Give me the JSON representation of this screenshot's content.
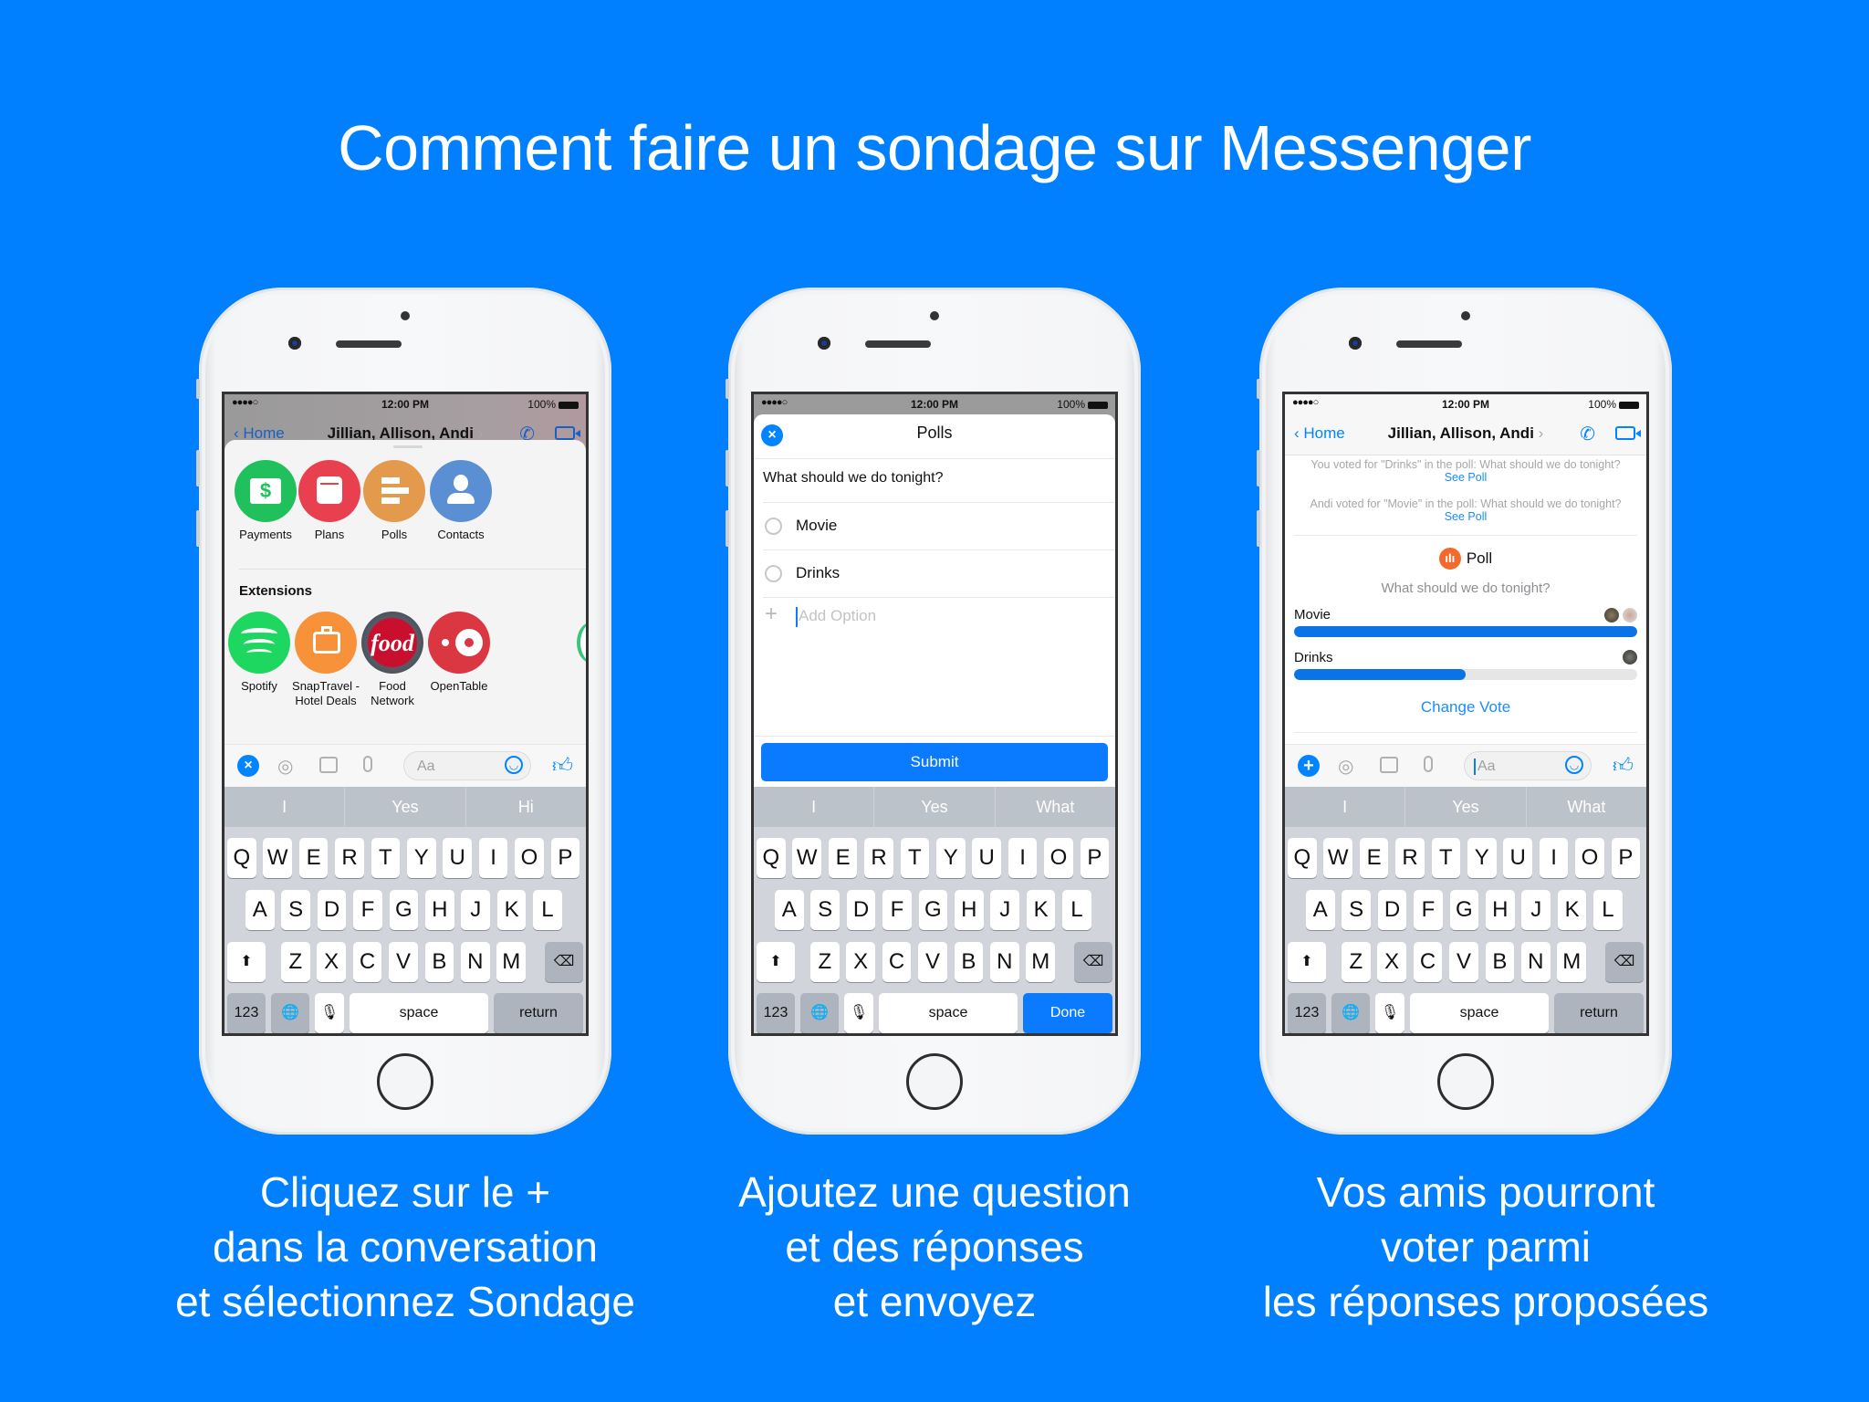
{
  "title": "Comment faire un sondage sur Messenger",
  "colors": {
    "background": "#0080ff",
    "messenger_blue": "#0084ff",
    "bar_fill": "#0a74e6"
  },
  "status_bar": {
    "signal": "●●●●○",
    "wifi_icon": "wifi-icon",
    "time": "12:00 PM",
    "battery": "100%"
  },
  "keyboard": {
    "row1": [
      "Q",
      "W",
      "E",
      "R",
      "T",
      "Y",
      "U",
      "I",
      "O",
      "P"
    ],
    "row2": [
      "A",
      "S",
      "D",
      "F",
      "G",
      "H",
      "J",
      "K",
      "L"
    ],
    "row3": [
      "Z",
      "X",
      "C",
      "V",
      "B",
      "N",
      "M"
    ],
    "shift_icon": "⬆",
    "delete_icon": "⌫",
    "num_label": "123",
    "globe_icon": "🌐",
    "mic_icon": "🎙",
    "space_label": "space"
  },
  "phones": [
    {
      "caption": [
        "Cliquez sur le +",
        "dans la conversation",
        "et sélectionnez Sondage"
      ],
      "nav": {
        "back": "Home",
        "title": "Jillian, Allison, Andi",
        "chevron": "›"
      },
      "apps": [
        {
          "label": "Payments",
          "icon": "payments-icon",
          "color": "#20c05c"
        },
        {
          "label": "Plans",
          "icon": "calendar-icon",
          "color": "#e9404f"
        },
        {
          "label": "Polls",
          "icon": "polls-icon",
          "color": "#e39a4c"
        },
        {
          "label": "Contacts",
          "icon": "contact-icon",
          "color": "#5a8fd3"
        }
      ],
      "extensions_heading": "Extensions",
      "extensions": [
        {
          "label": [
            "Spotify"
          ],
          "color": "#1ed760"
        },
        {
          "label": [
            "SnapTravel -",
            "Hotel Deals"
          ],
          "color": "#f7913a"
        },
        {
          "label": [
            "Food",
            "Network"
          ],
          "color": "#c8102e",
          "badge": "food"
        },
        {
          "label": [
            "OpenTable"
          ],
          "color": "#da3743"
        }
      ],
      "composer_placeholder": "Aa",
      "composer_button": "×",
      "suggestions": [
        "I",
        "Yes",
        "Hi"
      ],
      "return_label": "return"
    },
    {
      "caption": [
        "Ajoutez une question",
        "et des réponses",
        "et envoyez"
      ],
      "header_title": "Polls",
      "close_icon": "×",
      "question": "What should we do tonight?",
      "options": [
        "Movie",
        "Drinks"
      ],
      "add_option_placeholder": "Add Option",
      "submit_label": "Submit",
      "suggestions": [
        "I",
        "Yes",
        "What"
      ],
      "return_label": "Done"
    },
    {
      "caption": [
        "Vos amis pourront",
        "voter parmi",
        "les réponses proposées"
      ],
      "nav": {
        "back": "Home",
        "title": "Jillian, Allison, Andi",
        "chevron": "›"
      },
      "messages": [
        {
          "text": "You voted for \"Drinks\" in the poll: What should we do tonight?",
          "link": "See Poll"
        },
        {
          "text": "Andi voted for \"Movie\" in the poll: What should we do tonight?",
          "link": "See Poll"
        }
      ],
      "poll_label": "Poll",
      "poll_question": "What should we do tonight?",
      "results": [
        {
          "option": "Movie",
          "votes": 2,
          "fraction": 1.0
        },
        {
          "option": "Drinks",
          "votes": 1,
          "fraction": 0.5
        }
      ],
      "change_vote": "Change Vote",
      "composer_placeholder": "Aa",
      "composer_button": "+",
      "suggestions": [
        "I",
        "Yes",
        "What"
      ],
      "return_label": "return"
    }
  ]
}
